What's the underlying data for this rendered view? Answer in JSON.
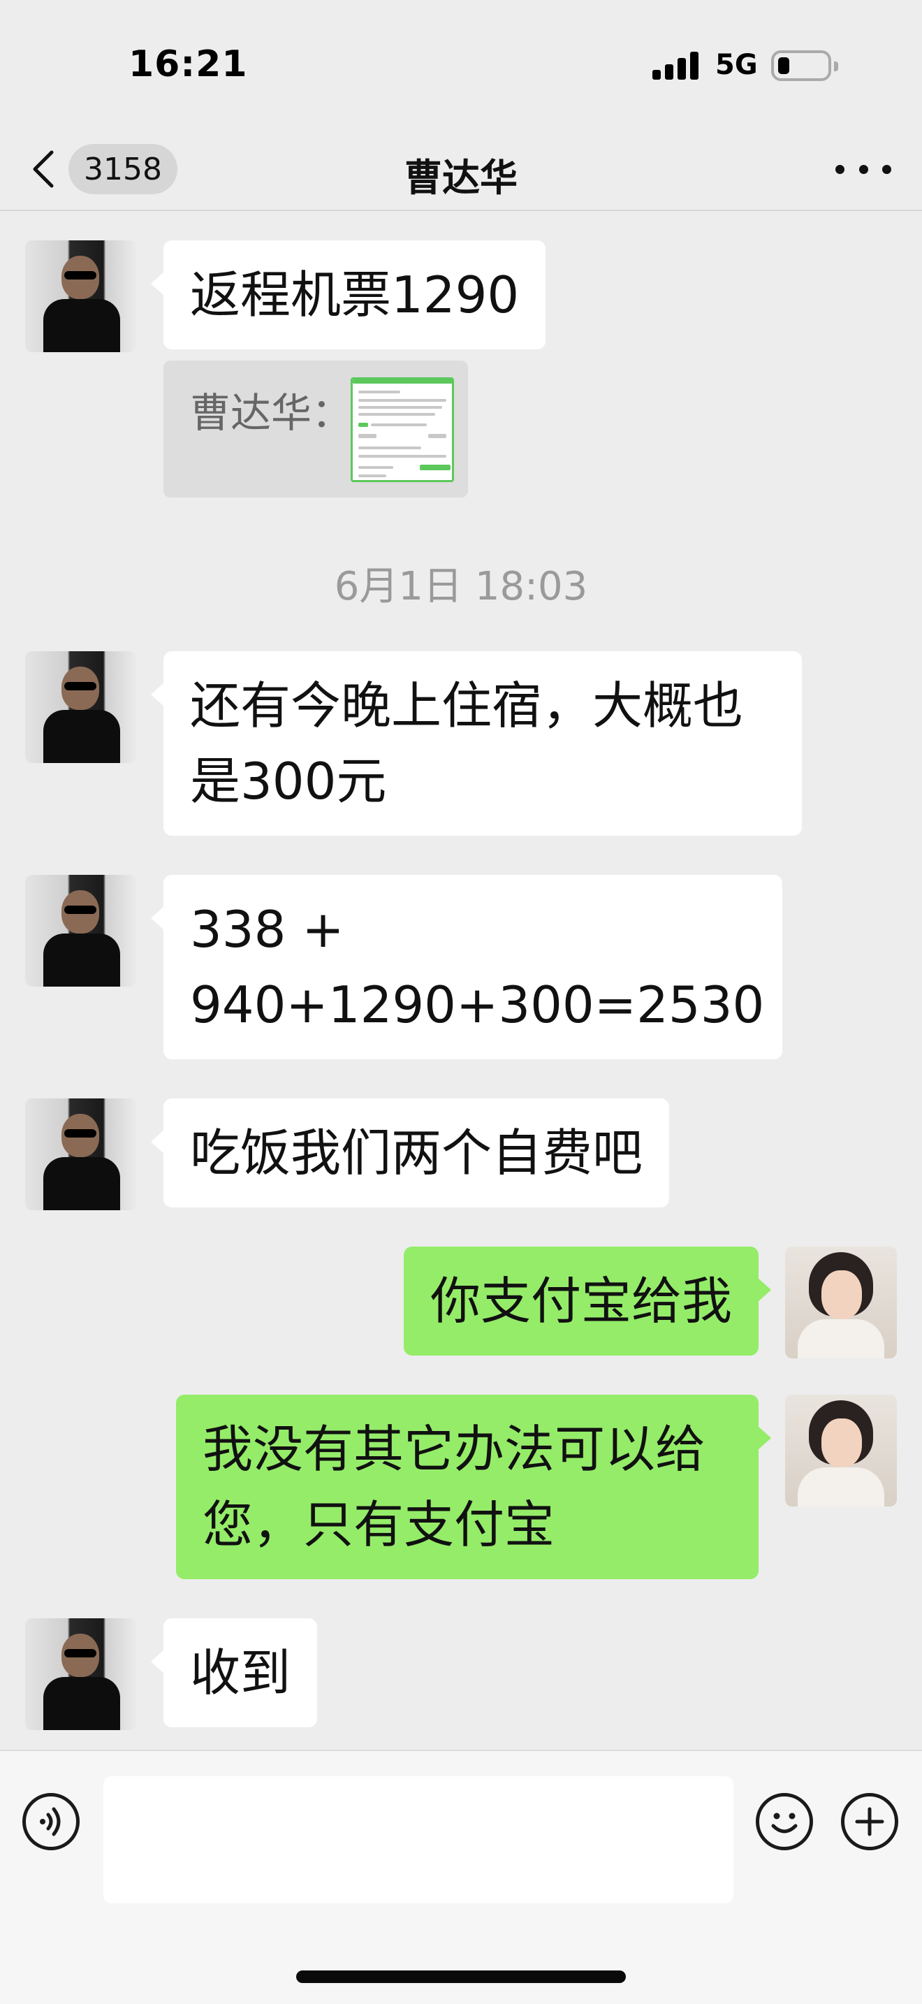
{
  "status_bar": {
    "time": "16:21",
    "network": "5G",
    "icons": [
      "signal-icon",
      "battery-icon"
    ]
  },
  "nav": {
    "back_icon": "chevron-left-icon",
    "unread_count": "3158",
    "title": "曹达华",
    "more_icon": "ellipsis-icon"
  },
  "messages": [
    {
      "sender": "contact",
      "text": "返程机票1290"
    },
    {
      "sender": "contact",
      "type": "quote",
      "label": "曹达华：",
      "thumbnail": "flight-screenshot-thumbnail"
    },
    {
      "type": "time",
      "text": "6月1日 18:03"
    },
    {
      "sender": "contact",
      "line1": "还有今晚上住宿，大概也",
      "line2": "是300元"
    },
    {
      "sender": "contact",
      "line1": "338 +",
      "line2": "940+1290+300=2530"
    },
    {
      "sender": "contact",
      "text": "吃饭我们两个自费吧"
    },
    {
      "sender": "me",
      "text": "你支付宝给我"
    },
    {
      "sender": "me",
      "line1": "我没有其它办法可以给",
      "line2": "您，只有支付宝"
    },
    {
      "sender": "contact",
      "text": "收到"
    }
  ],
  "input_bar": {
    "voice_icon": "voice-icon",
    "input_value": "",
    "emoji_icon": "emoji-icon",
    "plus_icon": "plus-icon"
  },
  "colors": {
    "background": "#ededed",
    "incoming_bubble": "#ffffff",
    "outgoing_bubble": "#95ec69",
    "time_label": "#9a9a9a"
  }
}
